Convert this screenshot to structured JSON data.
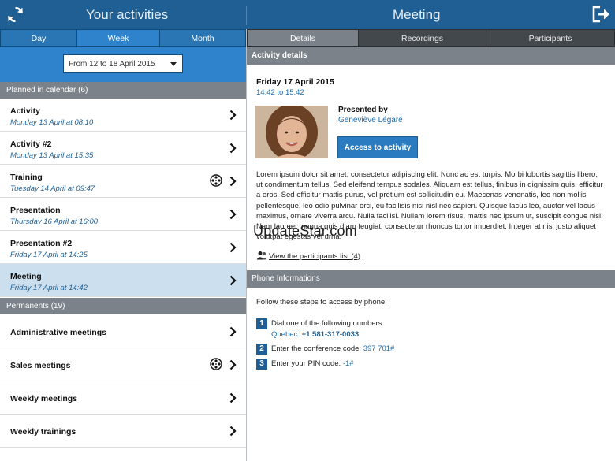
{
  "header": {
    "left_title": "Your activities",
    "right_title": "Meeting",
    "refresh_icon": "refresh-icon",
    "exit_icon": "exit-icon",
    "color": "#1f5f93"
  },
  "left_tabs": [
    {
      "label": "Day",
      "active": false
    },
    {
      "label": "Week",
      "active": true
    },
    {
      "label": "Month",
      "active": false
    }
  ],
  "date_selector": {
    "value": "From 12 to 18 April 2015"
  },
  "planned": {
    "header": "Planned in calendar (6)",
    "items": [
      {
        "title": "Activity",
        "date": "Monday 13 April at 08:10",
        "has_recording": false,
        "selected": false
      },
      {
        "title": "Activity #2",
        "date": "Monday 13 April at 15:35",
        "has_recording": false,
        "selected": false
      },
      {
        "title": "Training",
        "date": "Tuesday 14 April at 09:47",
        "has_recording": true,
        "selected": false
      },
      {
        "title": "Presentation",
        "date": "Thursday 16 April at 16:00",
        "has_recording": false,
        "selected": false
      },
      {
        "title": "Presentation #2",
        "date": "Friday 17 April at 14:25",
        "has_recording": false,
        "selected": false
      },
      {
        "title": "Meeting",
        "date": "Friday 17 April at 14:42",
        "has_recording": false,
        "selected": true
      }
    ]
  },
  "permanents": {
    "header": "Permanents (19)",
    "items": [
      {
        "title": "Administrative meetings",
        "has_recording": false
      },
      {
        "title": "Sales meetings",
        "has_recording": true
      },
      {
        "title": "Weekly meetings",
        "has_recording": false
      },
      {
        "title": "Weekly trainings",
        "has_recording": false
      }
    ]
  },
  "right_tabs": [
    {
      "label": "Details",
      "active": true
    },
    {
      "label": "Recordings",
      "active": false
    },
    {
      "label": "Participants",
      "active": false
    }
  ],
  "details": {
    "section_title": "Activity details",
    "date": "Friday 17 April 2015",
    "time": "14:42 to 15:42",
    "presented_by_label": "Presented by",
    "presenter": "Geneviève Légaré",
    "access_button": "Access to activity",
    "description": "Lorem ipsum dolor sit amet, consectetur adipiscing elit. Nunc ac est turpis. Morbi lobortis sagittis libero, ut condimentum tellus. Sed eleifend tempus sodales. Aliquam est tellus, finibus in dignissim quis, efficitur a eros. Sed efficitur mattis purus, vel pretium est sollicitudin eu. Maecenas venenatis, leo non mollis pellentesque, leo odio pulvinar orci, eu facilisis nisi nisl nec sapien. Quisque lacus leo, auctor vel lacus maximus, ornare viverra arcu. Nulla facilisi. Nullam lorem risus, mattis nec ipsum ut, suscipit congue nisi. Nam laoreet magna quis diam feugiat, consectetur rhoncus tortor imperdiet. Integer at nisi justo aliquet volutpat egestas vel urna.",
    "participants_link": "View the participants list (4)",
    "watermark": "UpdateStar.com"
  },
  "phone": {
    "section_title": "Phone Informations",
    "intro": "Follow these steps to access by phone:",
    "steps": [
      {
        "num": "1",
        "text": "Dial one of the following numbers:",
        "location": "Quebec:",
        "number": "+1 581-317-0033"
      },
      {
        "num": "2",
        "text": "Enter the conference code:",
        "value": "397 701#"
      },
      {
        "num": "3",
        "text": "Enter your PIN code:",
        "value": "-1#"
      }
    ]
  }
}
